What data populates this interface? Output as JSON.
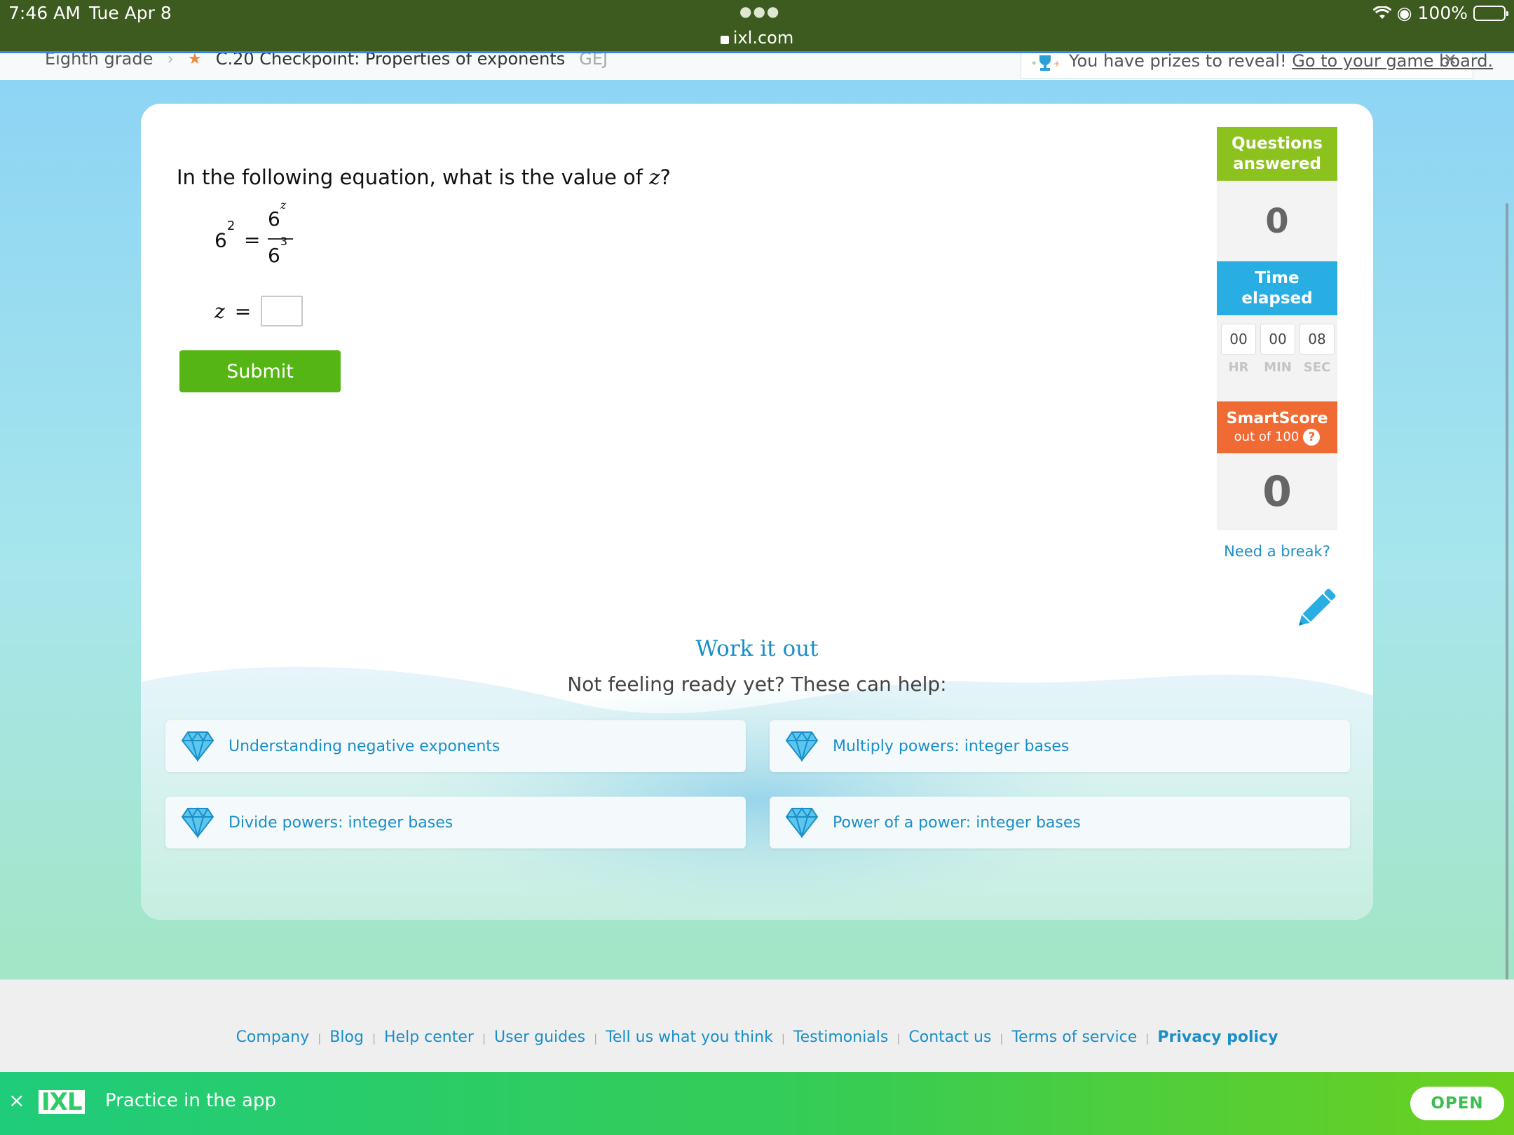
{
  "status_bar": {
    "time": "7:46 AM",
    "date": "Tue Apr 8",
    "url": "ixl.com",
    "battery": "100%"
  },
  "breadcrumb": {
    "grade": "Eighth grade",
    "skill": "C.20 Checkpoint: Properties of exponents",
    "code": "GEJ"
  },
  "prize_banner": {
    "text": "You have prizes to reveal!",
    "link": "Go to your game board."
  },
  "question": {
    "prompt": "In the following equation, what is the value of",
    "variable": "z",
    "end": "?",
    "lhs_base": "6",
    "lhs_exp": "2",
    "equals": "=",
    "num_base": "6",
    "num_exp": "z",
    "den_base": "6",
    "den_exp": "3",
    "answer_label": "z",
    "answer_equals": "=",
    "answer_value": "",
    "submit_label": "Submit"
  },
  "side_panel": {
    "questions_answered_label": "Questions answered",
    "questions_answered_value": "0",
    "time_elapsed_label": "Time elapsed",
    "hr": "00",
    "min": "00",
    "sec": "08",
    "hr_label": "HR",
    "min_label": "MIN",
    "sec_label": "SEC",
    "smartscore_label": "SmartScore",
    "smartscore_sub": "out of 100",
    "smartscore_help": "?",
    "smartscore_value": "0",
    "need_break": "Need a break?"
  },
  "work_it_out": {
    "title": "Work it out",
    "subtitle": "Not feeling ready yet? These can help:",
    "items": [
      {
        "label": "Understanding negative exponents"
      },
      {
        "label": "Multiply powers: integer bases"
      },
      {
        "label": "Divide powers: integer bases"
      },
      {
        "label": "Power of a power: integer bases"
      }
    ]
  },
  "footer": {
    "links": [
      "Company",
      "Blog",
      "Help center",
      "User guides",
      "Tell us what you think",
      "Testimonials",
      "Contact us",
      "Terms of service",
      "Privacy policy"
    ]
  },
  "app_banner": {
    "logo": "IXL",
    "text": "Practice in the app",
    "open": "OPEN",
    "close": "×"
  },
  "colors": {
    "accent_green": "#55b514",
    "questions_green": "#8cc21d",
    "time_blue": "#28aee3",
    "smartscore_orange": "#f06a34",
    "link_blue": "#1a8fc7"
  }
}
